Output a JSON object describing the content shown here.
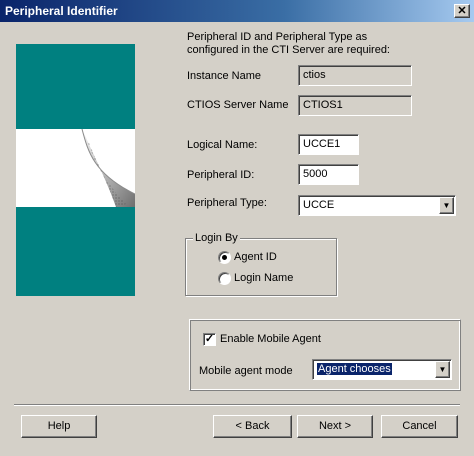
{
  "window": {
    "title": "Peripheral Identifier",
    "close_glyph": "✕"
  },
  "intro": {
    "line1": "Peripheral ID and Peripheral Type as",
    "line2": "configured in the CTI Server are required:"
  },
  "instance_name": {
    "label": "Instance Name",
    "value": "ctios"
  },
  "server_name": {
    "label": "CTIOS Server Name",
    "value": "CTIOS1"
  },
  "logical_name": {
    "label": "Logical Name:",
    "value": "UCCE1"
  },
  "peripheral_id": {
    "label": "Peripheral ID:",
    "value": "5000"
  },
  "peripheral_type": {
    "label": "Peripheral Type:",
    "value": "UCCE"
  },
  "login_by": {
    "title": "Login By",
    "options": [
      {
        "label": "Agent ID",
        "selected": true
      },
      {
        "label": "Login Name",
        "selected": false
      }
    ]
  },
  "mobile": {
    "enable_label": "Enable Mobile Agent",
    "enabled": true,
    "check_glyph": "✓",
    "mode_label": "Mobile agent mode",
    "mode_value": "Agent chooses"
  },
  "buttons": {
    "help": "Help",
    "back": "< Back",
    "next": "Next >",
    "cancel": "Cancel"
  },
  "icons": {
    "dropdown": "▼"
  }
}
